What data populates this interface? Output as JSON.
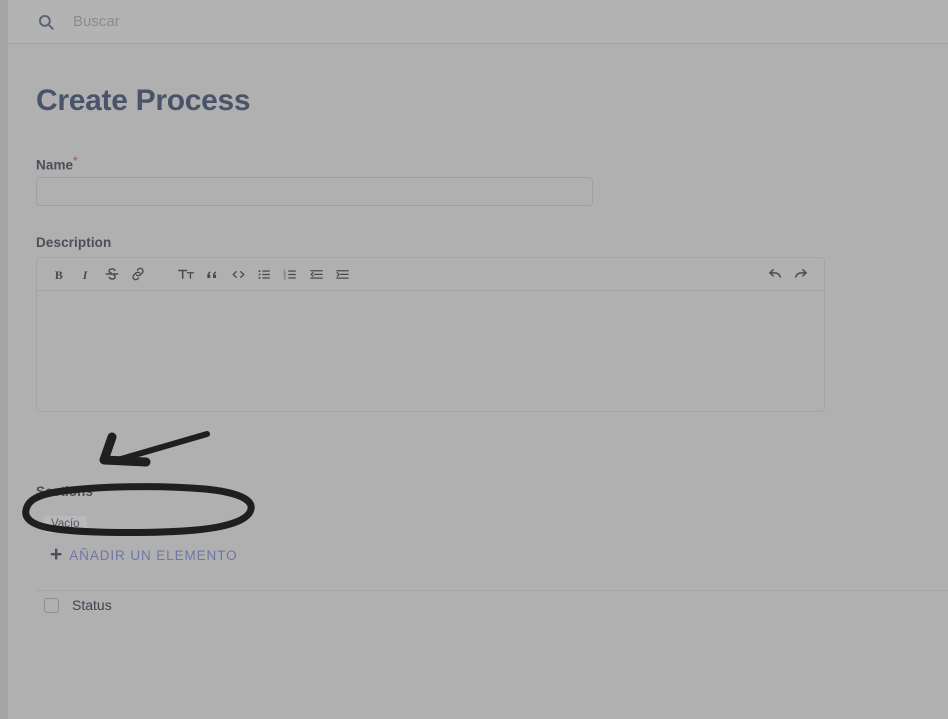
{
  "topbar": {
    "search_icon": "search-icon",
    "search_placeholder": "Buscar",
    "search_value": ""
  },
  "page": {
    "title": "Create Process"
  },
  "form": {
    "name": {
      "label": "Name",
      "required_marker": "*",
      "value": "",
      "placeholder": ""
    },
    "description": {
      "label": "Description",
      "value": "",
      "toolbar": [
        {
          "name": "bold-icon",
          "title": "Bold"
        },
        {
          "name": "italic-icon",
          "title": "Italic"
        },
        {
          "name": "strikethrough-icon",
          "title": "Strikethrough"
        },
        {
          "name": "link-icon",
          "title": "Link"
        },
        {
          "name": "heading-icon",
          "title": "Heading"
        },
        {
          "name": "quote-icon",
          "title": "Quote"
        },
        {
          "name": "code-icon",
          "title": "Code"
        },
        {
          "name": "bullet-list-icon",
          "title": "Bulleted list"
        },
        {
          "name": "numbered-list-icon",
          "title": "Numbered list"
        },
        {
          "name": "outdent-icon",
          "title": "Decrease indent"
        },
        {
          "name": "indent-icon",
          "title": "Increase indent"
        },
        {
          "name": "undo-icon",
          "title": "Undo"
        },
        {
          "name": "redo-icon",
          "title": "Redo"
        }
      ]
    },
    "sections": {
      "label": "Sections",
      "empty_badge": "Vacío",
      "add_element_label": "AÑADIR UN ELEMENTO",
      "add_element_plus": "+"
    },
    "status": {
      "label": "Status",
      "checked": false
    }
  },
  "annotations": {
    "arrow": {
      "name": "handdrawn-arrow",
      "points_at": "Sections"
    },
    "circle": {
      "name": "handdrawn-circle",
      "encircles": "AÑADIR UN ELEMENTO"
    },
    "ink_color": "#1f1f1f"
  },
  "colors": {
    "overlay_background": "#b0b0b0",
    "title_text": "#49546a",
    "link_text": "#6f76a3",
    "required_star": "#a4696b"
  }
}
